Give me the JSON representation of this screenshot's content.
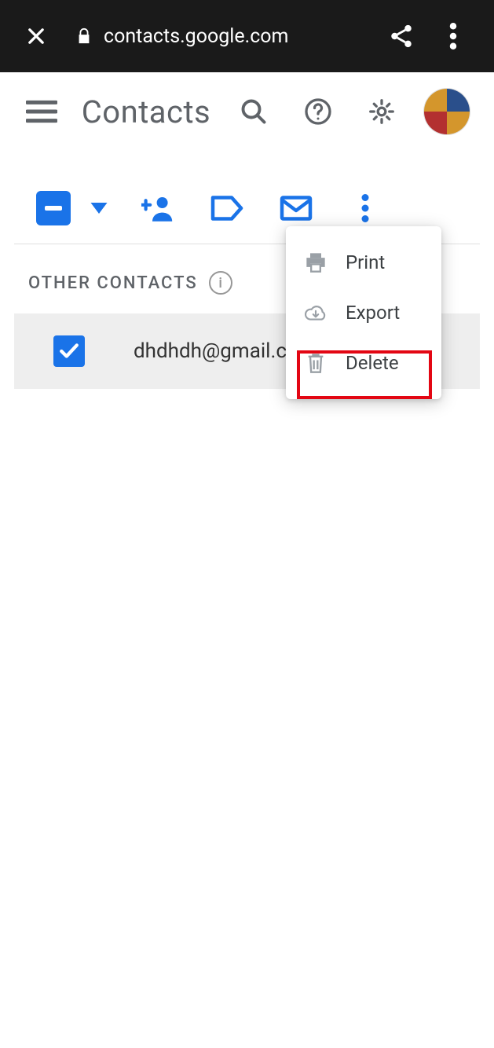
{
  "browser": {
    "url": "contacts.google.com"
  },
  "header": {
    "title": "Contacts"
  },
  "section": {
    "title": "OTHER CONTACTS",
    "info_glyph": "i"
  },
  "contacts": [
    {
      "email": "dhdhdh@gmail.com",
      "selected": true
    }
  ],
  "menu": {
    "items": [
      {
        "label": "Print"
      },
      {
        "label": "Export"
      },
      {
        "label": "Delete"
      }
    ]
  }
}
